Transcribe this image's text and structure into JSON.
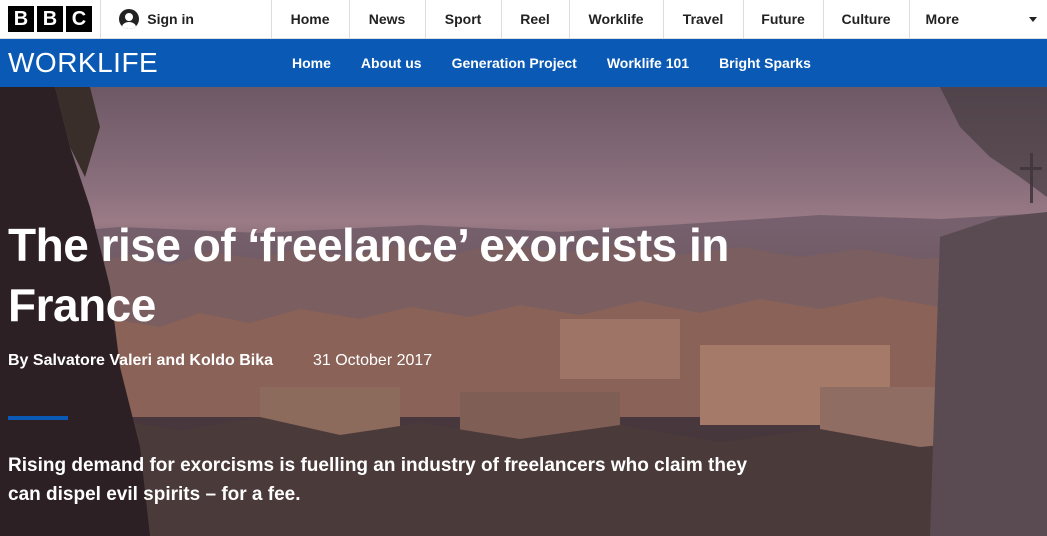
{
  "brand": {
    "logo_letters": [
      "B",
      "B",
      "C"
    ]
  },
  "account": {
    "signin_label": "Sign in"
  },
  "topnav": {
    "items": [
      "Home",
      "News",
      "Sport",
      "Reel",
      "Worklife",
      "Travel",
      "Future",
      "Culture"
    ],
    "more_label": "More"
  },
  "section": {
    "title": "WORKLIFE",
    "nav": [
      "Home",
      "About us",
      "Generation Project",
      "Worklife 101",
      "Bright Sparks"
    ]
  },
  "article": {
    "title": "The rise of ‘freelance’ exorcists in France",
    "authors": "By Salvatore Valeri and Koldo Bika",
    "date": "31 October 2017",
    "summary": "Rising demand for exorcisms is fuelling an industry of freelancers who claim they can dispel evil spirits – for a fee."
  },
  "colors": {
    "brand_blue": "#0a5ab5",
    "topbar_bg": "#ffffff",
    "text_dark": "#222222"
  }
}
